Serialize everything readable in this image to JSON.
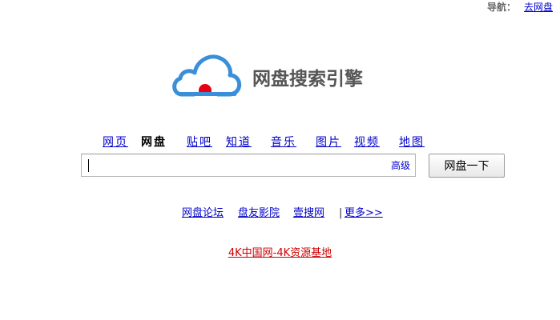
{
  "topnav": {
    "label": "导航：",
    "link": "去网盘"
  },
  "logo": {
    "text": "网盘搜索引擎",
    "cloud_color": "#3a8fd9",
    "dot_color": "#e60012"
  },
  "tabs": [
    {
      "label": "网页",
      "active": false
    },
    {
      "label": "网盘",
      "active": true
    },
    {
      "label": "贴吧",
      "active": false
    },
    {
      "label": "知道",
      "active": false
    },
    {
      "label": "音乐",
      "active": false
    },
    {
      "label": "图片",
      "active": false
    },
    {
      "label": "视频",
      "active": false
    },
    {
      "label": "地图",
      "active": false
    }
  ],
  "search": {
    "value": "",
    "placeholder": "",
    "advanced_label": "高级",
    "button_label": "网盘一下"
  },
  "links": {
    "items": [
      "网盘论坛",
      "盘友影院",
      "壹搜网"
    ],
    "separator": "|",
    "more": "更多>>"
  },
  "promo": {
    "label": "4K中国网-4K资源基地",
    "color": "#cc0000"
  }
}
